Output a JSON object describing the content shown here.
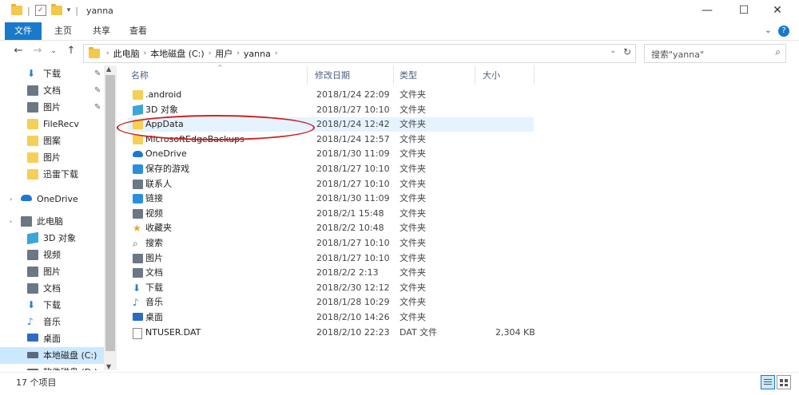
{
  "titlebar": {
    "title": "yanna",
    "separator": "|",
    "minimize": "—",
    "maximize": "☐",
    "close": "✕"
  },
  "ribbon": {
    "tabs": [
      "文件",
      "主页",
      "共享",
      "查看"
    ],
    "help": "?"
  },
  "address": {
    "back": "←",
    "forward": "→",
    "recent": "⌄",
    "up": "↑",
    "crumbs": [
      "此电脑",
      "本地磁盘 (C:)",
      "用户",
      "yanna"
    ],
    "crumb_sep": "›",
    "dropdown": "⌄",
    "refresh": "↻"
  },
  "search": {
    "placeholder": "搜索\"yanna\"",
    "icon": "search-icon"
  },
  "nav": {
    "items": [
      {
        "label": "下载",
        "icon": "download-icon",
        "pinned": true
      },
      {
        "label": "文档",
        "icon": "document-icon",
        "pinned": true
      },
      {
        "label": "图片",
        "icon": "picture-icon",
        "pinned": true
      },
      {
        "label": "FileRecv",
        "icon": "folder-icon",
        "pinned": false
      },
      {
        "label": "图案",
        "icon": "folder-icon",
        "pinned": false
      },
      {
        "label": "图片",
        "icon": "folder-icon",
        "pinned": false
      },
      {
        "label": "迅雷下载",
        "icon": "folder-icon",
        "pinned": false
      },
      {
        "label": "OneDrive",
        "icon": "cloud-icon",
        "pinned": false
      },
      {
        "label": "此电脑",
        "icon": "computer-icon",
        "pinned": false
      },
      {
        "label": "3D 对象",
        "icon": "cube-icon",
        "pinned": false
      },
      {
        "label": "视频",
        "icon": "video-icon",
        "pinned": false
      },
      {
        "label": "图片",
        "icon": "picture-icon",
        "pinned": false
      },
      {
        "label": "文档",
        "icon": "document-icon",
        "pinned": false
      },
      {
        "label": "下载",
        "icon": "download-icon",
        "pinned": false
      },
      {
        "label": "音乐",
        "icon": "music-icon",
        "pinned": false
      },
      {
        "label": "桌面",
        "icon": "desktop-icon",
        "pinned": false
      },
      {
        "label": "本地磁盘 (C:)",
        "icon": "drive-icon",
        "pinned": false,
        "selected": true
      },
      {
        "label": "软件磁盘 (D:)",
        "icon": "drive-icon",
        "pinned": false
      }
    ],
    "pin_glyph": "✎",
    "expand_glyph": "›"
  },
  "columns": {
    "name": "名称",
    "date": "修改日期",
    "type": "类型",
    "size": "大小",
    "sort_indicator": "^"
  },
  "files": [
    {
      "name": ".android",
      "date": "2018/1/24 22:09",
      "type": "文件夹",
      "size": "",
      "icon": "folder-icon"
    },
    {
      "name": "3D 对象",
      "date": "2018/1/27 10:10",
      "type": "文件夹",
      "size": "",
      "icon": "cube-icon"
    },
    {
      "name": "AppData",
      "date": "2018/1/24 12:42",
      "type": "文件夹",
      "size": "",
      "icon": "folder-icon",
      "selected": true
    },
    {
      "name": "MicrosoftEdgeBackups",
      "date": "2018/1/24 12:57",
      "type": "文件夹",
      "size": "",
      "icon": "folder-icon"
    },
    {
      "name": "OneDrive",
      "date": "2018/1/30 11:09",
      "type": "文件夹",
      "size": "",
      "icon": "cloud-icon"
    },
    {
      "name": "保存的游戏",
      "date": "2018/1/27 10:10",
      "type": "文件夹",
      "size": "",
      "icon": "game-icon"
    },
    {
      "name": "联系人",
      "date": "2018/1/27 10:10",
      "type": "文件夹",
      "size": "",
      "icon": "contacts-icon"
    },
    {
      "name": "链接",
      "date": "2018/1/30 11:09",
      "type": "文件夹",
      "size": "",
      "icon": "link-icon"
    },
    {
      "name": "视频",
      "date": "2018/2/1 15:48",
      "type": "文件夹",
      "size": "",
      "icon": "video-icon"
    },
    {
      "name": "收藏夹",
      "date": "2018/2/2 10:48",
      "type": "文件夹",
      "size": "",
      "icon": "star-icon"
    },
    {
      "name": "搜索",
      "date": "2018/1/27 10:10",
      "type": "文件夹",
      "size": "",
      "icon": "search-icon"
    },
    {
      "name": "图片",
      "date": "2018/1/27 10:10",
      "type": "文件夹",
      "size": "",
      "icon": "picture-icon"
    },
    {
      "name": "文档",
      "date": "2018/2/2 2:13",
      "type": "文件夹",
      "size": "",
      "icon": "document-icon"
    },
    {
      "name": "下载",
      "date": "2018/2/30 12:12",
      "type": "文件夹",
      "size": "",
      "icon": "download-icon"
    },
    {
      "name": "音乐",
      "date": "2018/1/28 10:29",
      "type": "文件夹",
      "size": "",
      "icon": "music-icon"
    },
    {
      "name": "桌面",
      "date": "2018/2/10 14:26",
      "type": "文件夹",
      "size": "",
      "icon": "desktop-icon"
    },
    {
      "name": "NTUSER.DAT",
      "date": "2018/2/10 22:23",
      "type": "DAT 文件",
      "size": "2,304 KB",
      "icon": "file-icon"
    }
  ],
  "status": {
    "count": "17 个项目"
  },
  "colors": {
    "accent": "#1979ca",
    "selection": "#cce8ff",
    "highlight_row": "#e5f3ff",
    "annotation": "#d0201c",
    "folder": "#f6cf57"
  }
}
